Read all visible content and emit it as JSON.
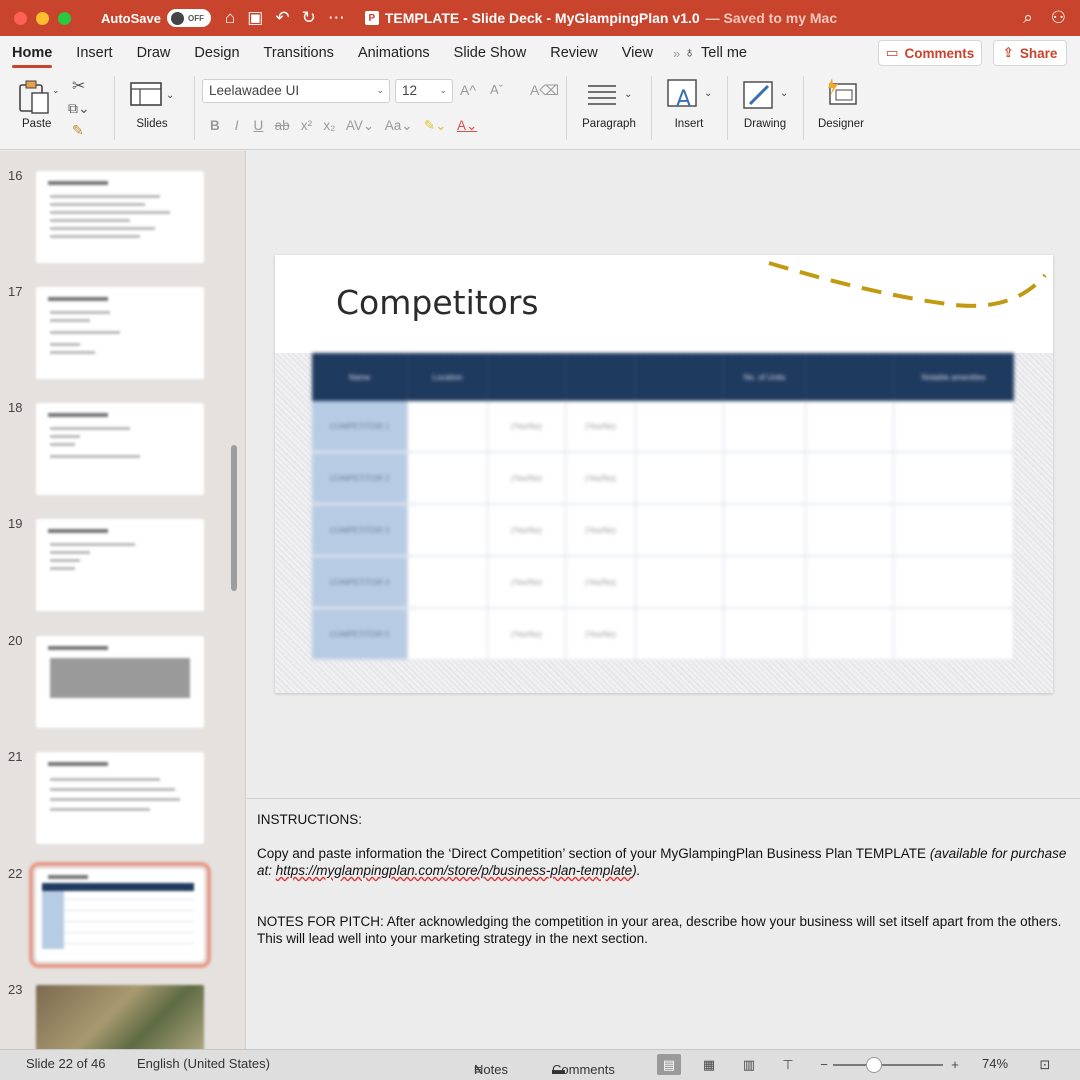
{
  "titlebar": {
    "autosave_label": "AutoSave",
    "autosave_state": "OFF",
    "doc_title": "TEMPLATE - Slide Deck - MyGlampingPlan v1.0",
    "saved_status": "— Saved to my Mac"
  },
  "ribbon_tabs": [
    "Home",
    "Insert",
    "Draw",
    "Design",
    "Transitions",
    "Animations",
    "Slide Show",
    "Review",
    "View"
  ],
  "tell_me": "Tell me",
  "buttons": {
    "comments": "Comments",
    "share": "Share"
  },
  "ribbon": {
    "paste": "Paste",
    "slides": "Slides",
    "font_name": "Leelawadee UI",
    "font_size": "12",
    "paragraph": "Paragraph",
    "insert": "Insert",
    "drawing": "Drawing",
    "designer": "Designer"
  },
  "thumbnails": [
    {
      "num": "16"
    },
    {
      "num": "17"
    },
    {
      "num": "18"
    },
    {
      "num": "19"
    },
    {
      "num": "20"
    },
    {
      "num": "21"
    },
    {
      "num": "22"
    },
    {
      "num": "23"
    }
  ],
  "slide": {
    "title": "Competitors",
    "table_headers": [
      "Name",
      "Location",
      "",
      "",
      "",
      "No. of Units",
      "",
      "Notable amenities"
    ],
    "rows": [
      [
        "COMPETITOR 1",
        "",
        "(Yes/No)",
        "(Yes/No)",
        "",
        "",
        "",
        ""
      ],
      [
        "COMPETITOR 2",
        "",
        "(Yes/No)",
        "(Yes/No)",
        "",
        "",
        "",
        ""
      ],
      [
        "COMPETITOR 3",
        "",
        "(Yes/No)",
        "(Yes/No)",
        "",
        "",
        "",
        ""
      ],
      [
        "COMPETITOR 4",
        "",
        "(Yes/No)",
        "(Yes/No)",
        "",
        "",
        "",
        ""
      ],
      [
        "COMPETITOR 5",
        "",
        "(Yes/No)",
        "(Yes/No)",
        "",
        "",
        "",
        ""
      ]
    ]
  },
  "notes": {
    "heading": "INSTRUCTIONS:",
    "para1": "Copy and paste information the ‘Direct Competition’ section of your MyGlampingPlan Business Plan TEMPLATE",
    "para1_italic_a": "(available for purchase at: ",
    "para1_url": "https://myglampingplan.com/store/p/business-plan-template",
    "para1_italic_b": ").",
    "para2": "NOTES FOR PITCH: After acknowledging the competition in your area, describe how your business will set itself apart from the others. This will lead well into your marketing strategy in the next section."
  },
  "status": {
    "slide_info": "Slide 22 of 46",
    "language": "English (United States)",
    "notes": "Notes",
    "comments": "Comments",
    "zoom": "74%"
  },
  "colors": {
    "accent": "#c8442c",
    "table_header": "#1f3a5f",
    "first_column": "#b7cce4",
    "decor_dash": "#c29a12"
  }
}
